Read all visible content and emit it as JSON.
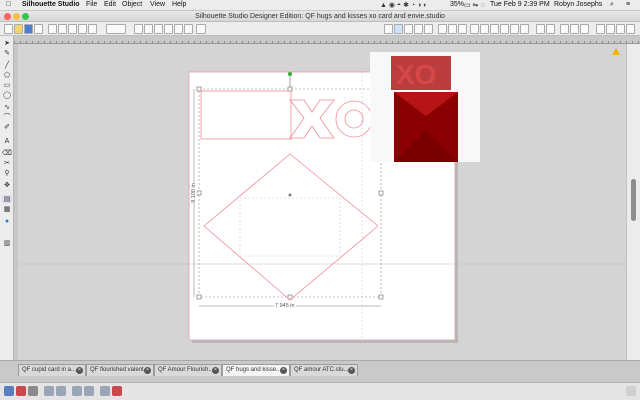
{
  "menubar": {
    "app": "Silhouette Studio",
    "items": [
      "File",
      "Edit",
      "Object",
      "View",
      "Help"
    ],
    "battery": "35%",
    "clock": "Tue Feb 9  2:39 PM",
    "user": "Robyn Josephs"
  },
  "window": {
    "title": "Silhouette Studio Designer Edition: QF hugs and kisses xo card and envie.studio"
  },
  "canvas": {
    "dim_width": "7.945 in",
    "dim_height": "8.100 in"
  },
  "tabs": [
    {
      "label": "QF cupid card in a..."
    },
    {
      "label": "QF flourished valent..."
    },
    {
      "label": "QF Amour Flourish..."
    },
    {
      "label": "QF hugs and kisse..."
    },
    {
      "label": "QF amour ATC.stu..."
    }
  ],
  "colors": {
    "cut_line": "#f08b98",
    "envelope": "#a01010",
    "mat": "#ffffff",
    "handle": "#3cb043"
  }
}
